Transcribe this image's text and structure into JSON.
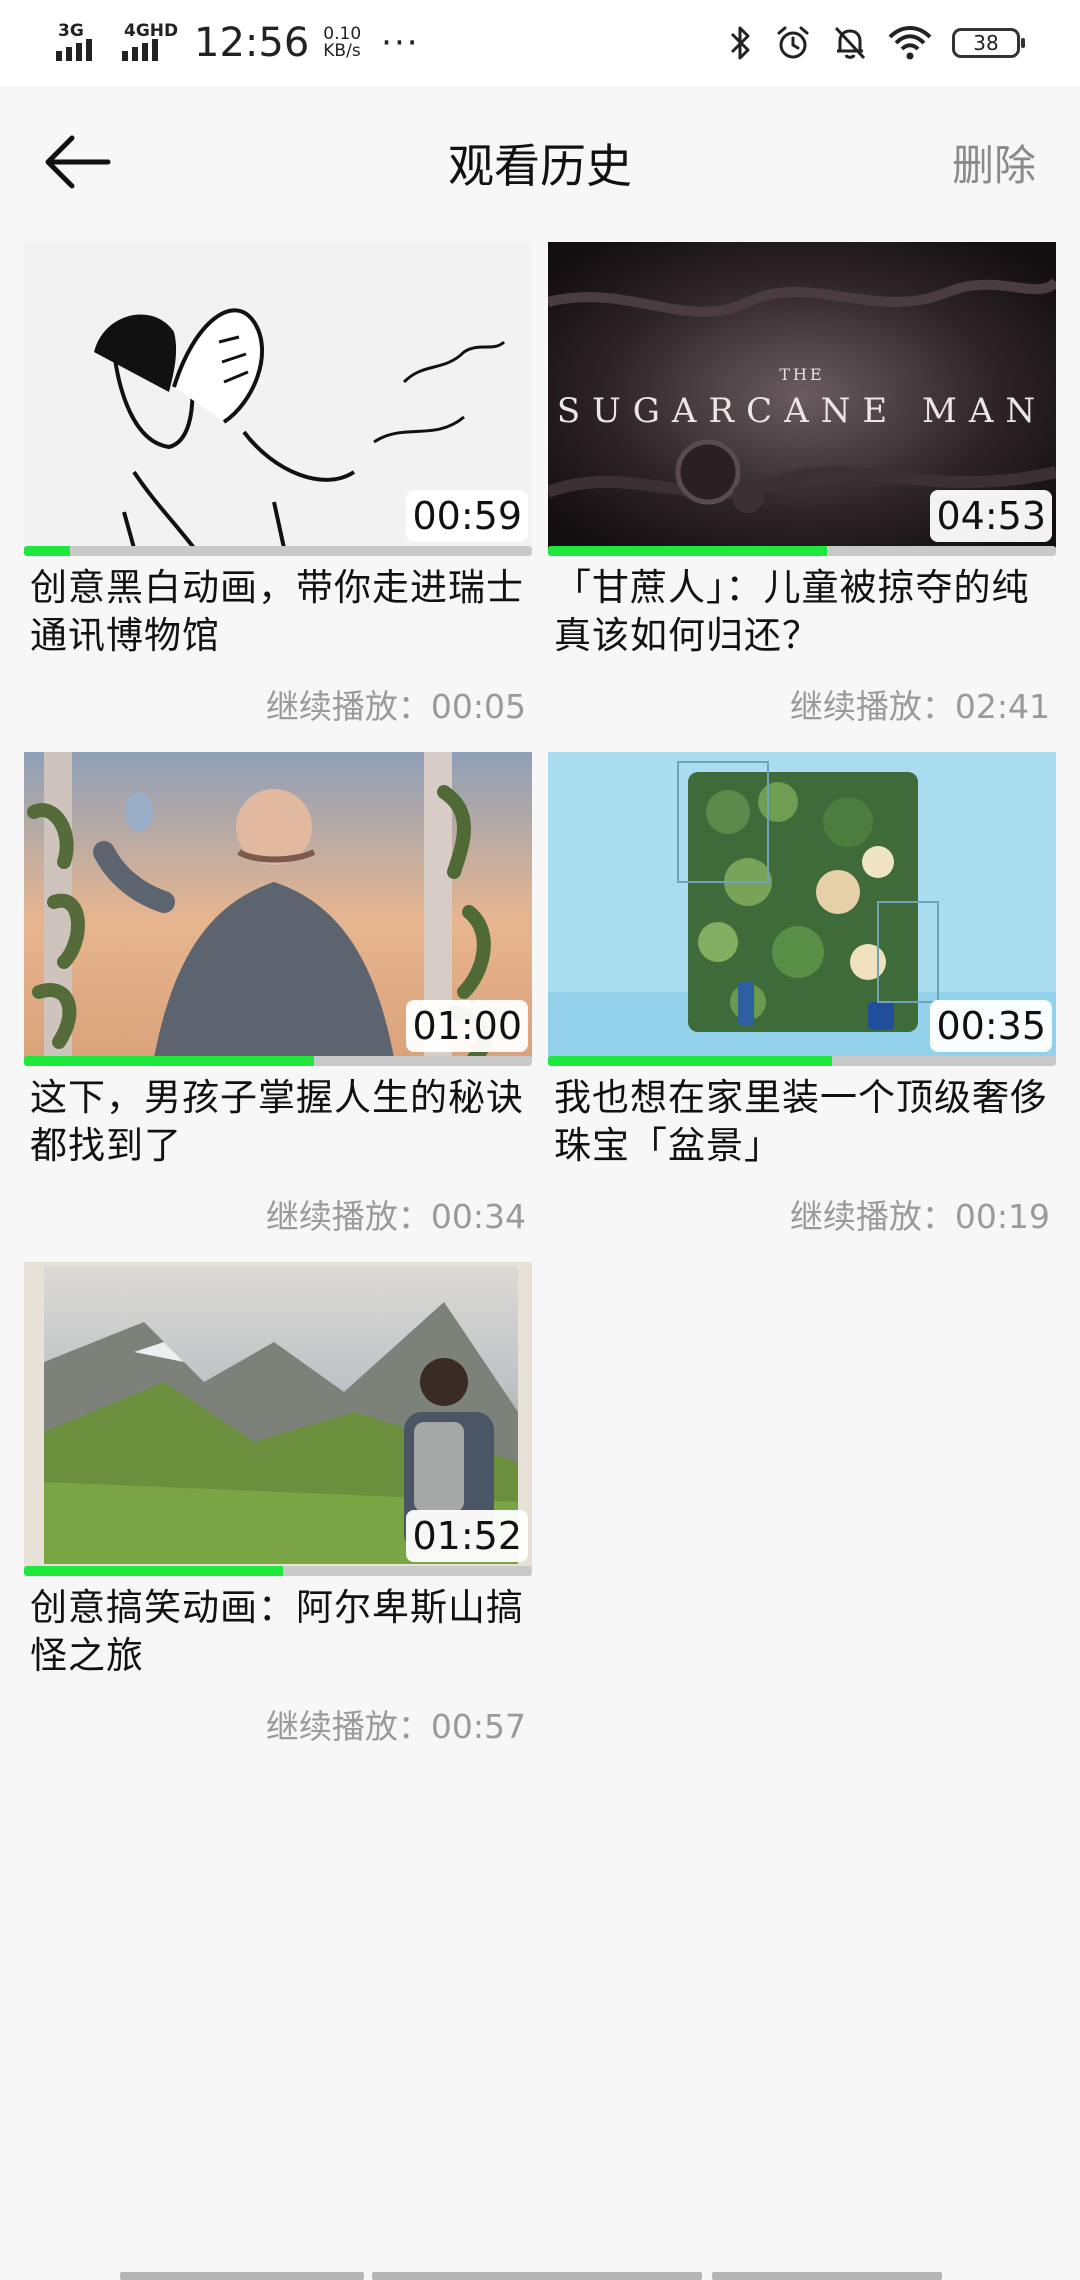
{
  "status_bar": {
    "signal1_label": "3G",
    "signal2_label": "4GHD",
    "time": "12:56",
    "speed_value": "0.10",
    "speed_unit": "KB/s",
    "more": "···",
    "battery": "38",
    "icons": [
      "bluetooth-icon",
      "alarm-icon",
      "mute-icon",
      "wifi-icon",
      "battery-icon"
    ]
  },
  "header": {
    "title": "观看历史",
    "delete_label": "删除",
    "back_icon": "arrow-left-icon"
  },
  "accent_color": "#1ee83c",
  "history": [
    {
      "title": "创意黑白动画，带你走进瑞士通讯博物馆",
      "duration": "00:59",
      "resume_label": "继续播放：",
      "resume_time": "00:05",
      "progress": 0.09
    },
    {
      "title": "「甘蔗人」：儿童被掠夺的纯真该如何归还？",
      "duration": "04:53",
      "resume_label": "继续播放：",
      "resume_time": "02:41",
      "progress": 0.55,
      "thumb_text_small": "THE",
      "thumb_text_big": "SUGARCANE MAN"
    },
    {
      "title": "这下，男孩子掌握人生的秘诀都找到了",
      "duration": "01:00",
      "resume_label": "继续播放：",
      "resume_time": "00:34",
      "progress": 0.57
    },
    {
      "title": "我也想在家里装一个顶级奢侈珠宝「盆景」",
      "duration": "00:35",
      "resume_label": "继续播放：",
      "resume_time": "00:19",
      "progress": 0.56
    },
    {
      "title": "创意搞笑动画：阿尔卑斯山搞怪之旅",
      "duration": "01:52",
      "resume_label": "继续播放：",
      "resume_time": "00:57",
      "progress": 0.51
    }
  ]
}
